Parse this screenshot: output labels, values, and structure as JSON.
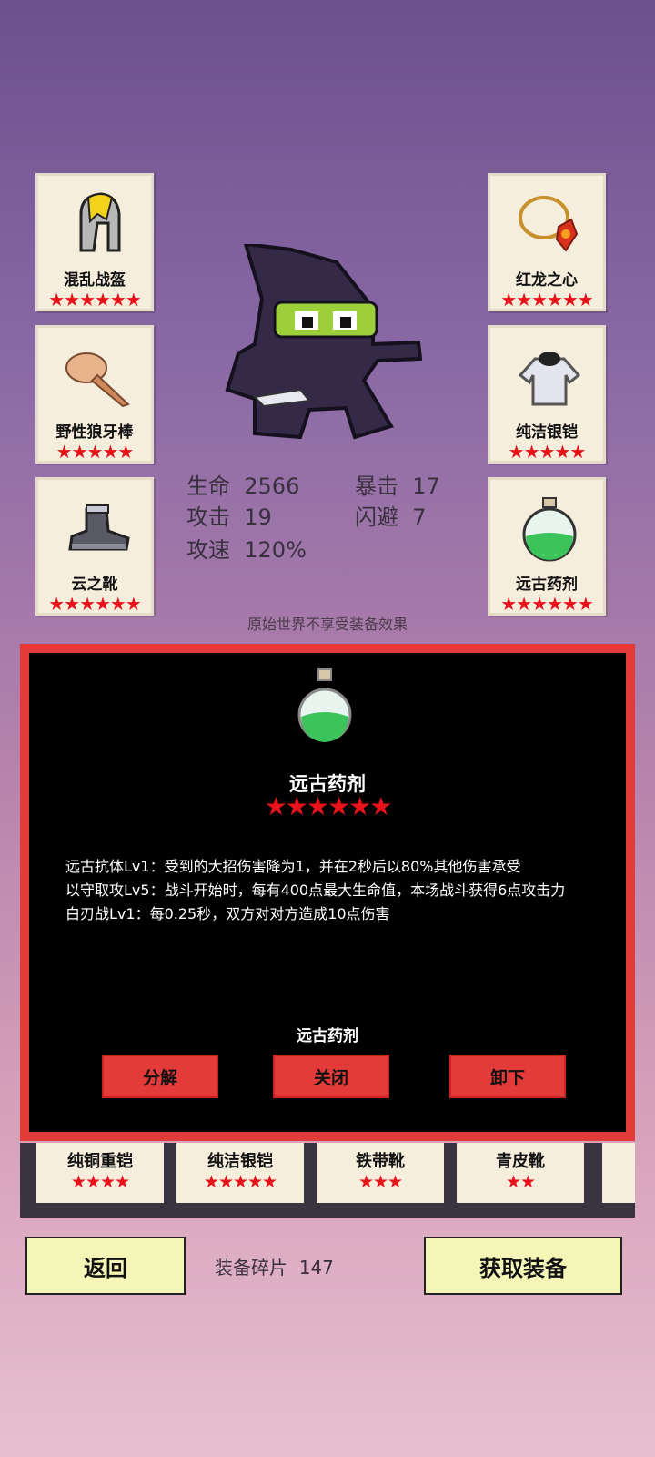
{
  "equipment": {
    "left": [
      {
        "name": "混乱战盔",
        "stars": "★★★★★★",
        "icon": "helmet-icon"
      },
      {
        "name": "野性狼牙棒",
        "stars": "★★★★★",
        "icon": "club-icon"
      },
      {
        "name": "云之靴",
        "stars": "★★★★★★",
        "icon": "boots-icon"
      }
    ],
    "right": [
      {
        "name": "红龙之心",
        "stars": "★★★★★★",
        "icon": "amulet-icon"
      },
      {
        "name": "纯洁银铠",
        "stars": "★★★★★",
        "icon": "armor-icon"
      },
      {
        "name": "远古药剂",
        "stars": "★★★★★★",
        "icon": "potion-icon"
      }
    ]
  },
  "stats": {
    "hp_label": "生命",
    "hp": "2566",
    "atk_label": "攻击",
    "atk": "19",
    "spd_label": "攻速",
    "spd": "120%",
    "crit_label": "暴击",
    "crit": "17",
    "dodge_label": "闪避",
    "dodge": "7"
  },
  "note": "原始世界不享受装备效果",
  "modal": {
    "title": "远古药剂",
    "stars": "★★★★★★",
    "lines": [
      "远古抗体Lv1：受到的大招伤害降为1，并在2秒后以80%其他伤害承受",
      "以守取攻Lv5：战斗开始时，每有400点最大生命值，本场战斗获得6点攻击力",
      "白刃战Lv1：每0.25秒，双方对对方造成10点伤害"
    ],
    "name2": "远古药剂",
    "buttons": {
      "decompose": "分解",
      "close": "关闭",
      "unequip": "卸下"
    }
  },
  "inventory": [
    {
      "name": "纯铜重铠",
      "stars": "★★★★"
    },
    {
      "name": "纯洁银铠",
      "stars": "★★★★★"
    },
    {
      "name": "铁带靴",
      "stars": "★★★"
    },
    {
      "name": "青皮靴",
      "stars": "★★"
    }
  ],
  "footer": {
    "back": "返回",
    "fragments_label": "装备碎片",
    "fragments": "147",
    "get": "获取装备"
  },
  "colors": {
    "star": "#e8121a",
    "modal_border": "#e33a3a",
    "button_bg": "#f4f6b8"
  }
}
